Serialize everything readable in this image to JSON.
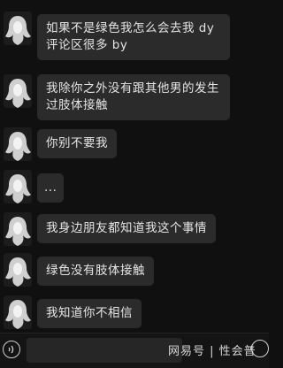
{
  "messages": [
    {
      "text": "如果不是绿色我怎么会去我 dy 评论区很多 by"
    },
    {
      "text": "我除你之外没有跟其他男的发生过肢体接触"
    },
    {
      "text": "你别不要我"
    },
    {
      "text": "..."
    },
    {
      "text": "我身边朋友都知道我这个事情"
    },
    {
      "text": "绿色没有肢体接触"
    },
    {
      "text": "我知道你不相信"
    }
  ],
  "bottom_bar": {
    "watermark": "网易号 | 性会普",
    "icons": {
      "voice": "voice-icon",
      "emoji": "emoji-icon",
      "avatar": "avatar-icon"
    }
  },
  "colors": {
    "background": "#101010",
    "bubble": "#2b2b2b",
    "text": "#e4e4e4"
  }
}
